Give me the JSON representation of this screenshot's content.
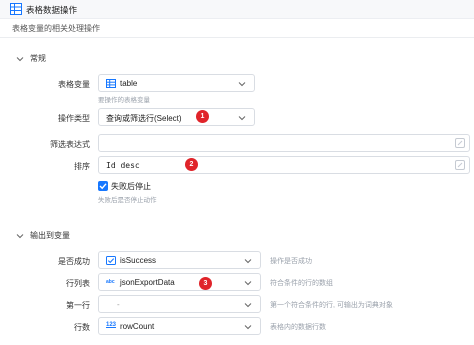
{
  "header": {
    "title": "表格数据操作",
    "subtitle": "表格变量的相关处理操作"
  },
  "sections": {
    "general": "常规",
    "output": "输出到变量"
  },
  "form": {
    "table_var": {
      "label": "表格变量",
      "value": "table",
      "hint": "要操作的表格变量"
    },
    "operation": {
      "label": "操作类型",
      "value": "查询或筛选行(Select)"
    },
    "filter": {
      "label": "筛选表达式",
      "value": ""
    },
    "sort": {
      "label": "排序",
      "value": "Id desc"
    },
    "stop_on_fail": {
      "label": "失败后停止",
      "hint": "失败后是否停止动作",
      "checked": true
    }
  },
  "outputs": {
    "success": {
      "label": "是否成功",
      "type_icon": "boolean-icon",
      "value": "isSuccess",
      "hint": "操作是否成功"
    },
    "rows": {
      "label": "行列表",
      "type_icon": "abc",
      "value": "jsonExportData",
      "hint": "符合条件的行的数组"
    },
    "first_row": {
      "label": "第一行",
      "value": "-",
      "hint": "第一个符合条件的行, 可输出为词典对象"
    },
    "row_count": {
      "label": "行数",
      "type_icon": "123",
      "value": "rowCount",
      "hint": "表格内的数据行数"
    }
  },
  "badges": [
    "1",
    "2",
    "3"
  ],
  "colors": {
    "accent": "#1677ff",
    "badge": "#e0242a",
    "border": "#d9dde3"
  }
}
